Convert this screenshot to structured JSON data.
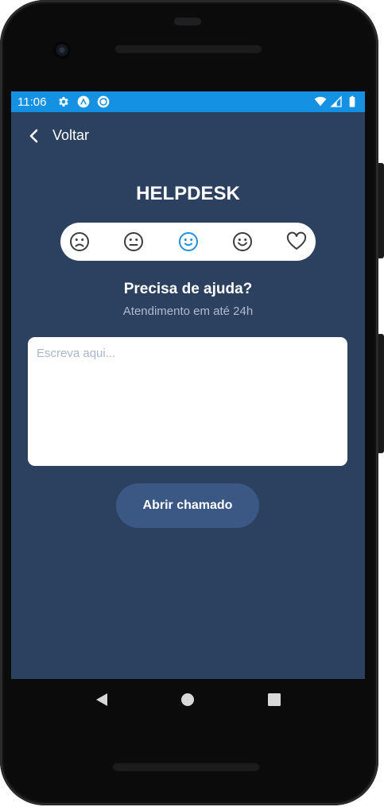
{
  "status_bar": {
    "time": "11:06",
    "left_icons": [
      "settings-icon",
      "expo-icon",
      "sync-icon"
    ],
    "right_icons": [
      "wifi-icon",
      "signal-icon",
      "battery-icon"
    ],
    "color": "#1591e3"
  },
  "nav": {
    "back_label": "Voltar"
  },
  "header": {
    "title": "HELPDESK"
  },
  "rating": {
    "options": [
      "sad-face-icon",
      "neutral-face-icon",
      "smile-face-icon",
      "happy-face-icon",
      "heart-icon"
    ],
    "selected_index": 2,
    "selected_color": "#1f8fe0",
    "default_color": "#3d3d40"
  },
  "form": {
    "heading": "Precisa de ajuda?",
    "caption": "Atendimento em até 24h",
    "message_placeholder": "Escreva aqui...",
    "message_value": "",
    "submit_label": "Abrir chamado"
  },
  "theme": {
    "background": "#2c4160",
    "button": "#3b5784"
  },
  "android_nav": [
    "back-triangle-icon",
    "home-circle-icon",
    "recents-square-icon"
  ]
}
